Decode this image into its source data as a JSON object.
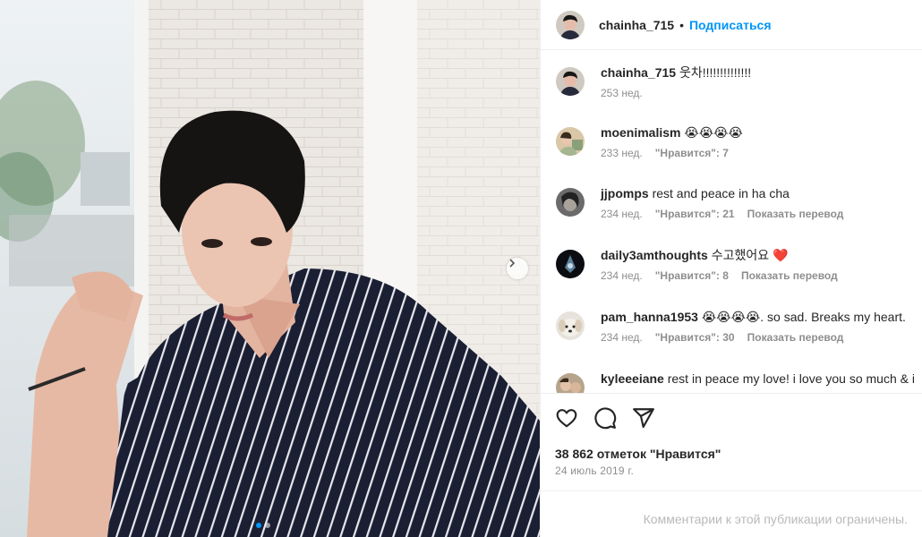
{
  "post": {
    "username": "chainha_715",
    "follow_label": "Подписаться",
    "separator": "•",
    "likes_text": "38 862 отметок \"Нравится\"",
    "date": "24 июль 2019 г.",
    "comments_limited": "Комментарии к этой публикации ограничены."
  },
  "comments": [
    {
      "user": "chainha_715",
      "text": "웃차!!!!!!!!!!!!!!",
      "age": "253 нед.",
      "likes": "",
      "translate": ""
    },
    {
      "user": "moenimalism",
      "text": "😭😭😭😭",
      "age": "233 нед.",
      "likes": "\"Нравится\": 7",
      "translate": ""
    },
    {
      "user": "jjpomps",
      "text": "rest and peace in ha cha",
      "age": "234 нед.",
      "likes": "\"Нравится\": 21",
      "translate": "Показать перевод"
    },
    {
      "user": "daily3amthoughts",
      "text": "수고했어요 ❤️",
      "age": "234 нед.",
      "likes": "\"Нравится\": 8",
      "translate": "Показать перевод"
    },
    {
      "user": "pam_hanna1953",
      "text": "😭😭😭😭. so sad. Breaks my heart.",
      "age": "234 нед.",
      "likes": "\"Нравится\": 30",
      "translate": "Показать перевод"
    },
    {
      "user": "kyleeeiane",
      "text": "rest in peace my love! i love you so much & i",
      "age": "",
      "likes": "",
      "translate": ""
    }
  ],
  "carousel": {
    "total": 2,
    "active": 1
  },
  "colors": {
    "accent": "#0095f6",
    "muted": "#8e8e8e",
    "text": "#262626"
  },
  "icons": [
    "heart-icon",
    "comment-icon",
    "share-icon",
    "chevron-right-icon"
  ]
}
